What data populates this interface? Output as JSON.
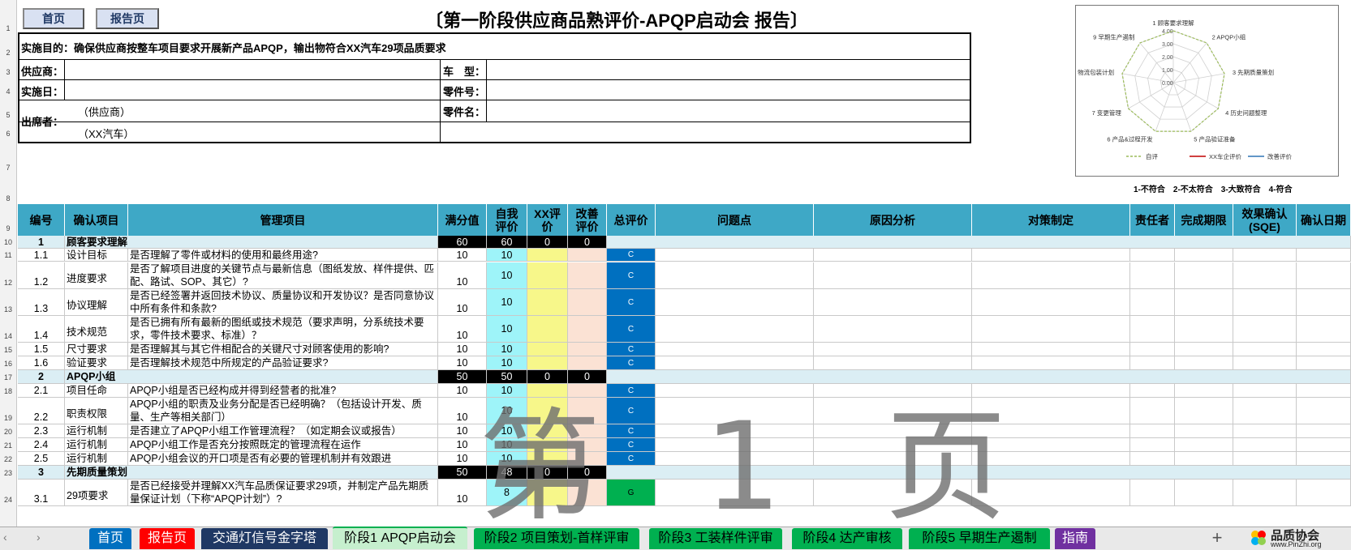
{
  "nav": {
    "home": "首页",
    "report": "报告页"
  },
  "title": "〔第一阶段供应商品熟评价-APQP启动会 报告〕",
  "info": {
    "purpose": "实施目的：确保供应商按整车项目要求开展新产品APQP，输出物符合XX汽车29项品质要求",
    "supplier": "供应商：",
    "car_type": "车　型：",
    "date": "实施日：",
    "part_no": "零件号：",
    "attendee": "出席者：",
    "part_name": "零件名：",
    "att_supplier": "（供应商）",
    "att_xx": "（XX汽车）"
  },
  "radar": {
    "axes": [
      "1 顾客要求理解",
      "2 APQP小组",
      "3 先期质量策划",
      "4 历史问题整理",
      "5 产品验证准备",
      "6 产品&过程开发",
      "7 变更管理",
      "8 物流包装计划",
      "9 早期生产遏制"
    ],
    "ticks": [
      "4.00",
      "3.00",
      "2.00",
      "1.00",
      "0.00"
    ],
    "legend": [
      "自评",
      "XX车企评价",
      "改善评价"
    ],
    "colors": [
      "#9bbb59",
      "#c00000",
      "#2e75b6"
    ],
    "self_values": [
      4,
      4,
      4,
      4,
      4,
      4,
      4,
      4,
      4
    ]
  },
  "scale_legend": "1-不符合　2-不太符合　3-大致符合　4-符合",
  "headers": {
    "no": "编号",
    "item": "确认项目",
    "mgmt": "管理项目",
    "full": "满分值",
    "self1": "自我",
    "self2": "评价",
    "xx1": "XX评",
    "xx2": "价",
    "imp1": "改善",
    "imp2": "评价",
    "total": "总评价",
    "issue": "问题点",
    "cause": "原因分析",
    "measure": "对策制定",
    "owner": "责任者",
    "deadline": "完成期限",
    "effect1": "效果确认",
    "effect2": "(SQE)",
    "confirm": "确认日期"
  },
  "rows": [
    {
      "r": "10",
      "type": "section",
      "no": "1",
      "item": "顾客要求理解",
      "full": "60",
      "self": "60",
      "xx": "0",
      "imp": "0"
    },
    {
      "r": "11",
      "type": "item",
      "no": "1.1",
      "item": "设计目标",
      "mgmt": "是否理解了零件或材料的使用和最终用途?",
      "full": "10",
      "self": "10",
      "total": "C"
    },
    {
      "r": "12",
      "type": "item",
      "no": "1.2",
      "item": "进度要求",
      "mgmt": "是否了解项目进度的关键节点与最新信息（图纸发放、样件提供、匹配、路试、SOP、其它）?",
      "full": "10",
      "self": "10",
      "total": "C"
    },
    {
      "r": "13",
      "type": "item",
      "no": "1.3",
      "item": "协议理解",
      "mgmt": "是否已经签署并返回技术协议、质量协议和开发协议？是否同意协议中所有条件和条款?",
      "full": "10",
      "self": "10",
      "total": "C"
    },
    {
      "r": "14",
      "type": "item",
      "no": "1.4",
      "item": "技术规范",
      "mgmt": "是否已拥有所有最新的图纸或技术规范（要求声明，分系统技术要求，零件技术要求、标准）？",
      "full": "10",
      "self": "10",
      "total": "C"
    },
    {
      "r": "15",
      "type": "item",
      "no": "1.5",
      "item": "尺寸要求",
      "mgmt": "是否理解其与其它件相配合的关键尺寸对顾客使用的影响?",
      "full": "10",
      "self": "10",
      "total": "C"
    },
    {
      "r": "16",
      "type": "item",
      "no": "1.6",
      "item": "验证要求",
      "mgmt": "是否理解技术规范中所规定的产品验证要求?",
      "full": "10",
      "self": "10",
      "total": "C"
    },
    {
      "r": "17",
      "type": "section",
      "no": "2",
      "item": "APQP小组",
      "full": "50",
      "self": "50",
      "xx": "0",
      "imp": "0"
    },
    {
      "r": "18",
      "type": "item",
      "no": "2.1",
      "item": "项目任命",
      "mgmt": "APQP小组是否已经构成并得到经营者的批准?",
      "full": "10",
      "self": "10",
      "total": "C"
    },
    {
      "r": "19",
      "type": "item",
      "no": "2.2",
      "item": "职责权限",
      "mgmt": "APQP小组的职责及业务分配是否已经明确？（包括设计开发、质量、生产等相关部门）",
      "full": "10",
      "self": "10",
      "total": "C"
    },
    {
      "r": "20",
      "type": "item",
      "no": "2.3",
      "item": "运行机制",
      "mgmt": "是否建立了APQP小组工作管理流程？（如定期会议或报告）",
      "full": "10",
      "self": "10",
      "total": "C"
    },
    {
      "r": "21",
      "type": "item",
      "no": "2.4",
      "item": "运行机制",
      "mgmt": "APQP小组工作是否充分按照既定的管理流程在运作",
      "full": "10",
      "self": "10",
      "total": "C"
    },
    {
      "r": "22",
      "type": "item",
      "no": "2.5",
      "item": "运行机制",
      "mgmt": "APQP小组会议的开口项是否有必要的管理机制并有效跟进",
      "full": "10",
      "self": "10",
      "total": "C"
    },
    {
      "r": "23",
      "type": "section",
      "no": "3",
      "item": "先期质量策划",
      "full": "50",
      "self": "48",
      "xx": "0",
      "imp": "0"
    },
    {
      "r": "24",
      "type": "item",
      "no": "3.1",
      "item": "29项要求",
      "mgmt": "是否已经接受并理解XX汽车品质保证要求29项，并制定产品先期质量保证计划（下称“APQP计划”）?",
      "full": "10",
      "self": "8",
      "total": "G"
    }
  ],
  "watermark": "第 1 页",
  "row_labels": [
    "1",
    "2",
    "3",
    "4",
    "5",
    "6",
    "7",
    "8",
    "9"
  ],
  "tabs": [
    "首页",
    "报告页",
    "交通灯信号金字塔",
    "阶段1 APQP启动会",
    "阶段2 项目策划-首样评审",
    "阶段3 工装样件评审",
    "阶段4 达产审核",
    "阶段5 早期生产遏制",
    "指南"
  ],
  "tab_colors": [
    "#0070c0",
    "#ff0000",
    "#1f3864",
    "#c6efce",
    "#00b050",
    "#00b050",
    "#00b050",
    "#00b050",
    "#7030a0"
  ],
  "logo": {
    "name": "品质协会",
    "url": "www.PinZhi.org"
  }
}
